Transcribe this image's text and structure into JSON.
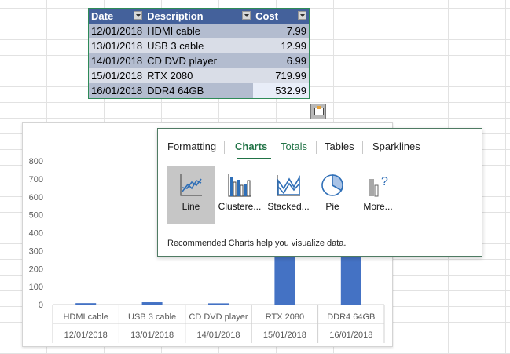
{
  "table": {
    "headers": [
      "Date",
      "Description",
      "Cost"
    ],
    "rows": [
      {
        "date": "12/01/2018",
        "description": "HDMI cable",
        "cost": "7.99"
      },
      {
        "date": "13/01/2018",
        "description": "USB 3 cable",
        "cost": "12.99"
      },
      {
        "date": "14/01/2018",
        "description": "CD DVD player",
        "cost": "6.99"
      },
      {
        "date": "15/01/2018",
        "description": "RTX 2080",
        "cost": "719.99"
      },
      {
        "date": "16/01/2018",
        "description": "DDR4 64GB",
        "cost": "532.99"
      }
    ]
  },
  "quick_analysis": {
    "tabs": [
      "Formatting",
      "Charts",
      "Totals",
      "Tables",
      "Sparklines"
    ],
    "active_tab": "Charts",
    "options": [
      {
        "label": "Line",
        "icon": "line-chart-icon"
      },
      {
        "label": "Clustere...",
        "icon": "clustered-bar-chart-icon"
      },
      {
        "label": "Stacked...",
        "icon": "stacked-area-chart-icon"
      },
      {
        "label": "Pie",
        "icon": "pie-chart-icon"
      },
      {
        "label": "More...",
        "icon": "more-charts-icon"
      }
    ],
    "hint": "Recommended Charts help you visualize data."
  },
  "chart_data": {
    "type": "bar",
    "categories": [
      "HDMI cable",
      "USB 3 cable",
      "CD DVD player",
      "RTX 2080",
      "DDR4 64GB"
    ],
    "dates": [
      "12/01/2018",
      "13/01/2018",
      "14/01/2018",
      "15/01/2018",
      "16/01/2018"
    ],
    "values": [
      7.99,
      12.99,
      6.99,
      719.99,
      532.99
    ],
    "ylim": [
      0,
      800
    ],
    "yticks": [
      "0",
      "100",
      "200",
      "300",
      "400",
      "500",
      "600",
      "700",
      "800"
    ],
    "grid": false,
    "bar_color": "#4472c4"
  }
}
